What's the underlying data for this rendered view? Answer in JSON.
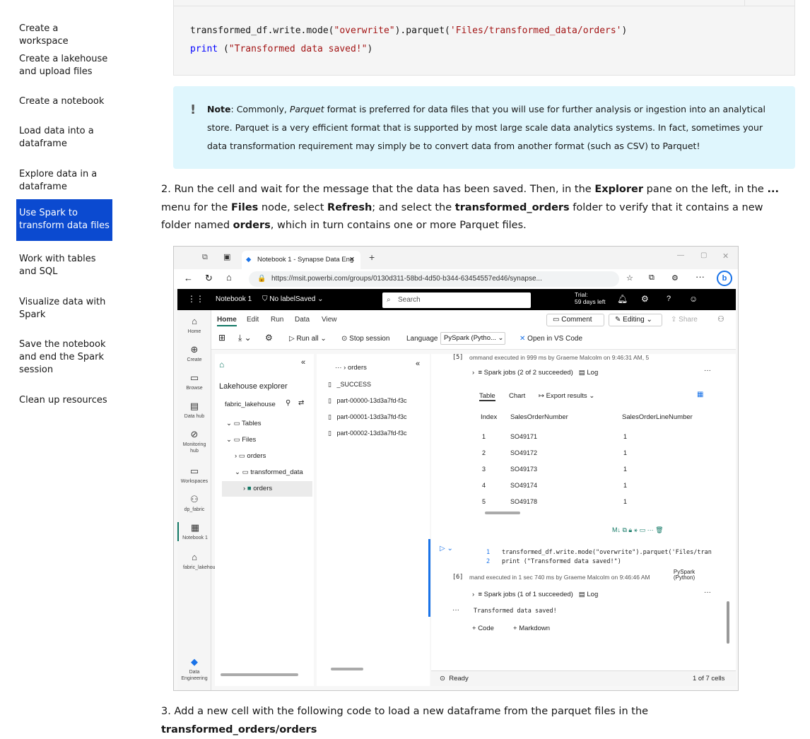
{
  "toc": [
    {
      "label": "Create a workspace",
      "active": false
    },
    {
      "label": "Create a lakehouse and upload files",
      "active": false
    },
    {
      "label": "Create a notebook",
      "active": false
    },
    {
      "label": "Load data into a dataframe",
      "active": false
    },
    {
      "label": "Explore data in a dataframe",
      "active": false
    },
    {
      "label": "Use Spark to transform data files",
      "active": true
    },
    {
      "label": "Work with tables and SQL",
      "active": false
    },
    {
      "label": "Visualize data with Spark",
      "active": false
    },
    {
      "label": "Save the notebook and end the Spark session",
      "active": false
    },
    {
      "label": "Clean up resources",
      "active": false
    }
  ],
  "code": {
    "line1_a": "transformed_df.write.mode(",
    "line1_b": "\"overwrite\"",
    "line1_c": ").parquet(",
    "line1_d": "'Files/transformed_data/orders'",
    "line1_e": ")",
    "line2_a": "print",
    "line2_b": " (",
    "line2_c": "\"Transformed data saved!\"",
    "line2_d": ")"
  },
  "note": {
    "icon": "!",
    "label": "Note",
    "text1": ": Commonly, ",
    "italic": "Parquet",
    "text2": " format is preferred for data files that you will use for further analysis or ingestion into an analytical store. Parquet is a very efficient format that is supported by most large scale data analytics systems. In fact, sometimes your data transformation requirement may simply be to convert data from another format (such as CSV) to Parquet!"
  },
  "step2": {
    "num": "2.",
    "t1": "Run the cell and wait for the message that the data has been saved. Then, in the ",
    "b1": "Explorer",
    "t2": " pane on the left, in the ",
    "b2": "...",
    "t3": " menu for the ",
    "b3": "Files",
    "t4": " node, select ",
    "b4": "Refresh",
    "t5": "; and select the ",
    "b5": "transformed_orders",
    "t6": " folder to verify that it contains a new folder named ",
    "b6": "orders",
    "t7": ", which in turn contains one or more Parquet files."
  },
  "step3": {
    "num": "3.",
    "t1": "Add a new cell with the following code to load a new dataframe from the parquet files in the ",
    "b1": "transformed_orders/orders"
  },
  "shot": {
    "tab_title": "Notebook 1 - Synapse Data Eng",
    "url": "https://msit.powerbi.com/groups/0130d311-58bd-4d50-b344-63454557ed46/synapse...",
    "notebook_name": "Notebook 1",
    "label": "No labelSaved",
    "search_placeholder": "Search",
    "trial": "Trial:",
    "trial_days": "59 days left",
    "rail": [
      "Home",
      "Create",
      "Browse",
      "Data hub",
      "Monitoring hub",
      "Workspaces",
      "dp_fabric",
      "Notebook 1",
      "fabric_lakehouse",
      "Data Engineering"
    ],
    "ribbon_tabs": [
      "Home",
      "Edit",
      "Run",
      "Data",
      "View"
    ],
    "comment": "Comment",
    "editing": "Editing",
    "share": "Share",
    "run_all": "Run all",
    "stop_session": "Stop session",
    "language_label": "Language",
    "language_value": "PySpark (Pytho...",
    "open_vscode": "Open in VS Code",
    "explorer_title": "Lakehouse explorer",
    "lakehouse": "fabric_lakehouse",
    "tree": [
      "Tables",
      "Files",
      "orders",
      "transformed_data",
      "orders"
    ],
    "files_crumb": "orders",
    "files": [
      "_SUCCESS",
      "part-00000-13d3a7fd-f3c",
      "part-00001-13d3a7fd-f3c",
      "part-00002-13d3a7fd-f3c"
    ],
    "cell5_exec": "ommand executed in 999 ms by Graeme Malcolm on 9:46:31 AM, 5",
    "cell5_num": "[5]",
    "spark_jobs_5": "Spark jobs (2 of 2 succeeded)",
    "log": "Log",
    "result_tabs": [
      "Table",
      "Chart",
      "Export results"
    ],
    "table_headers": [
      "Index",
      "SalesOrderNumber",
      "SalesOrderLineNumber"
    ],
    "table_rows": [
      [
        "1",
        "SO49171",
        "1"
      ],
      [
        "2",
        "SO49172",
        "1"
      ],
      [
        "3",
        "SO49173",
        "1"
      ],
      [
        "4",
        "SO49174",
        "1"
      ],
      [
        "5",
        "SO49178",
        "1"
      ]
    ],
    "cell6_line1": "transformed_df.write.mode(\"overwrite\").parquet('Files/tran",
    "cell6_line2": "print (\"Transformed data saved!\")",
    "cell6_num": "[6]",
    "cell6_exec": "mand executed in 1 sec 740 ms by Graeme Malcolm on 9:46:46 AM",
    "cell6_lang": "PySpark (Python)",
    "spark_jobs_6": "Spark jobs (1 of 1 succeeded)",
    "output": "Transformed data saved!",
    "add_code": "Code",
    "add_markdown": "Markdown",
    "status": "Ready",
    "cells": "1 of 7 cells"
  }
}
